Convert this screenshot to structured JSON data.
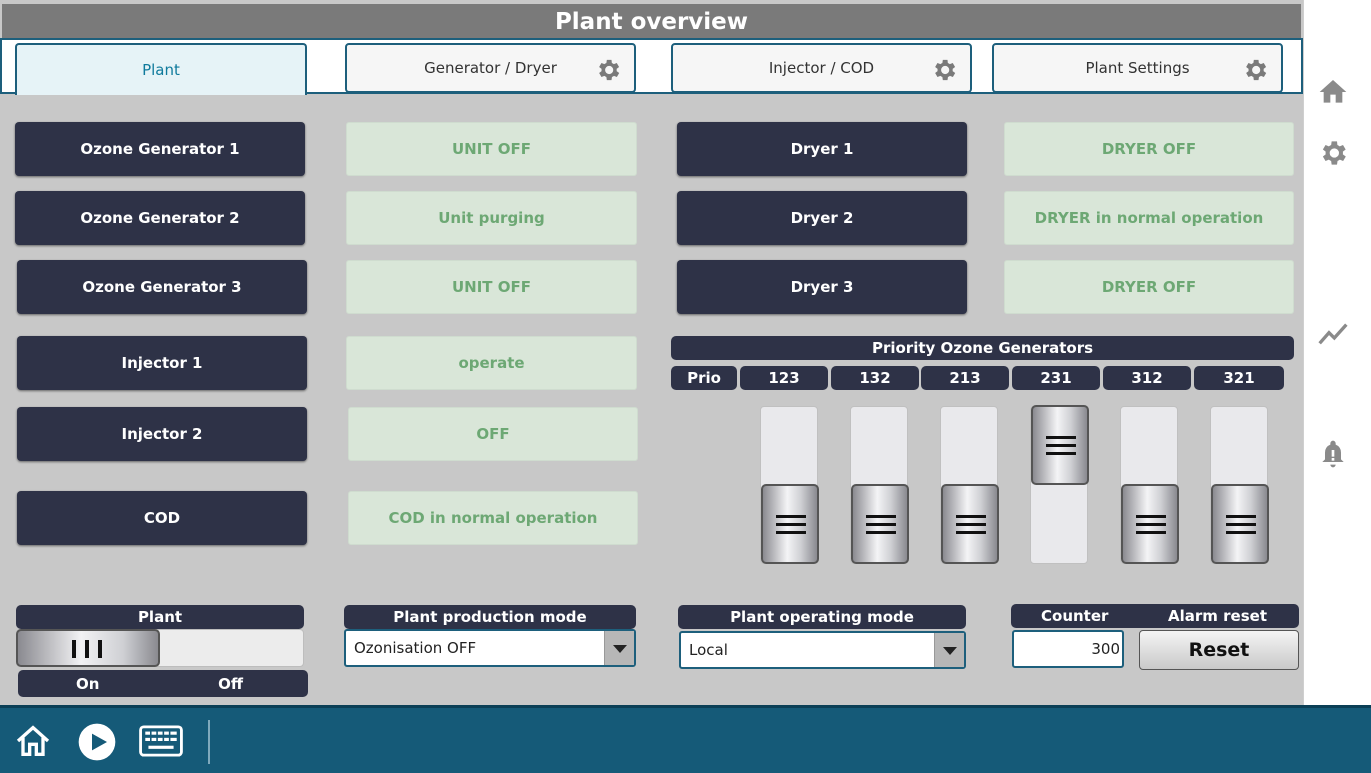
{
  "title": "Plant overview",
  "tabs": [
    {
      "label": "Plant",
      "active": true
    },
    {
      "label": "Generator / Dryer",
      "icon": "gear-icon"
    },
    {
      "label": "Injector / COD",
      "icon": "gear-icon"
    },
    {
      "label": "Plant Settings",
      "icon": "gear-icon"
    }
  ],
  "units": [
    {
      "name": "Ozone Generator 1",
      "status": "UNIT OFF"
    },
    {
      "name": "Ozone Generator 2",
      "status": "Unit purging"
    },
    {
      "name": "Ozone Generator 3",
      "status": "UNIT OFF"
    },
    {
      "name": "Injector 1",
      "status": "operate"
    },
    {
      "name": "Injector 2",
      "status": "OFF"
    },
    {
      "name": "COD",
      "status": "COD in normal operation"
    }
  ],
  "dryers": [
    {
      "name": "Dryer 1",
      "status": "DRYER OFF"
    },
    {
      "name": "Dryer 2",
      "status": "DRYER in normal operation"
    },
    {
      "name": "Dryer 3",
      "status": "DRYER OFF"
    }
  ],
  "priority": {
    "title": "Priority Ozone Generators",
    "prio_label": "Prio",
    "options": [
      "123",
      "132",
      "213",
      "231",
      "312",
      "321"
    ],
    "selected": "231"
  },
  "plant_switch": {
    "label": "Plant",
    "on_label": "On",
    "off_label": "Off",
    "state": "On"
  },
  "production_mode": {
    "label": "Plant production mode",
    "value": "Ozonisation OFF"
  },
  "operating_mode": {
    "label": "Plant operating mode",
    "value": "Local"
  },
  "counter": {
    "label": "Counter",
    "value": "300"
  },
  "alarm_reset": {
    "label": "Alarm reset",
    "button": "Reset"
  },
  "right_rail_icons": [
    "home-icon",
    "gear-icon",
    "trend-icon",
    "bell-icon"
  ],
  "taskbar_icons": [
    "home-icon",
    "play-icon",
    "keyboard-icon"
  ],
  "colors": {
    "accent": "#1d5f7c",
    "dark_button": "#2e3247",
    "status_bg": "#d9e6d8",
    "status_text": "#6da874",
    "taskbar": "#155a78"
  }
}
